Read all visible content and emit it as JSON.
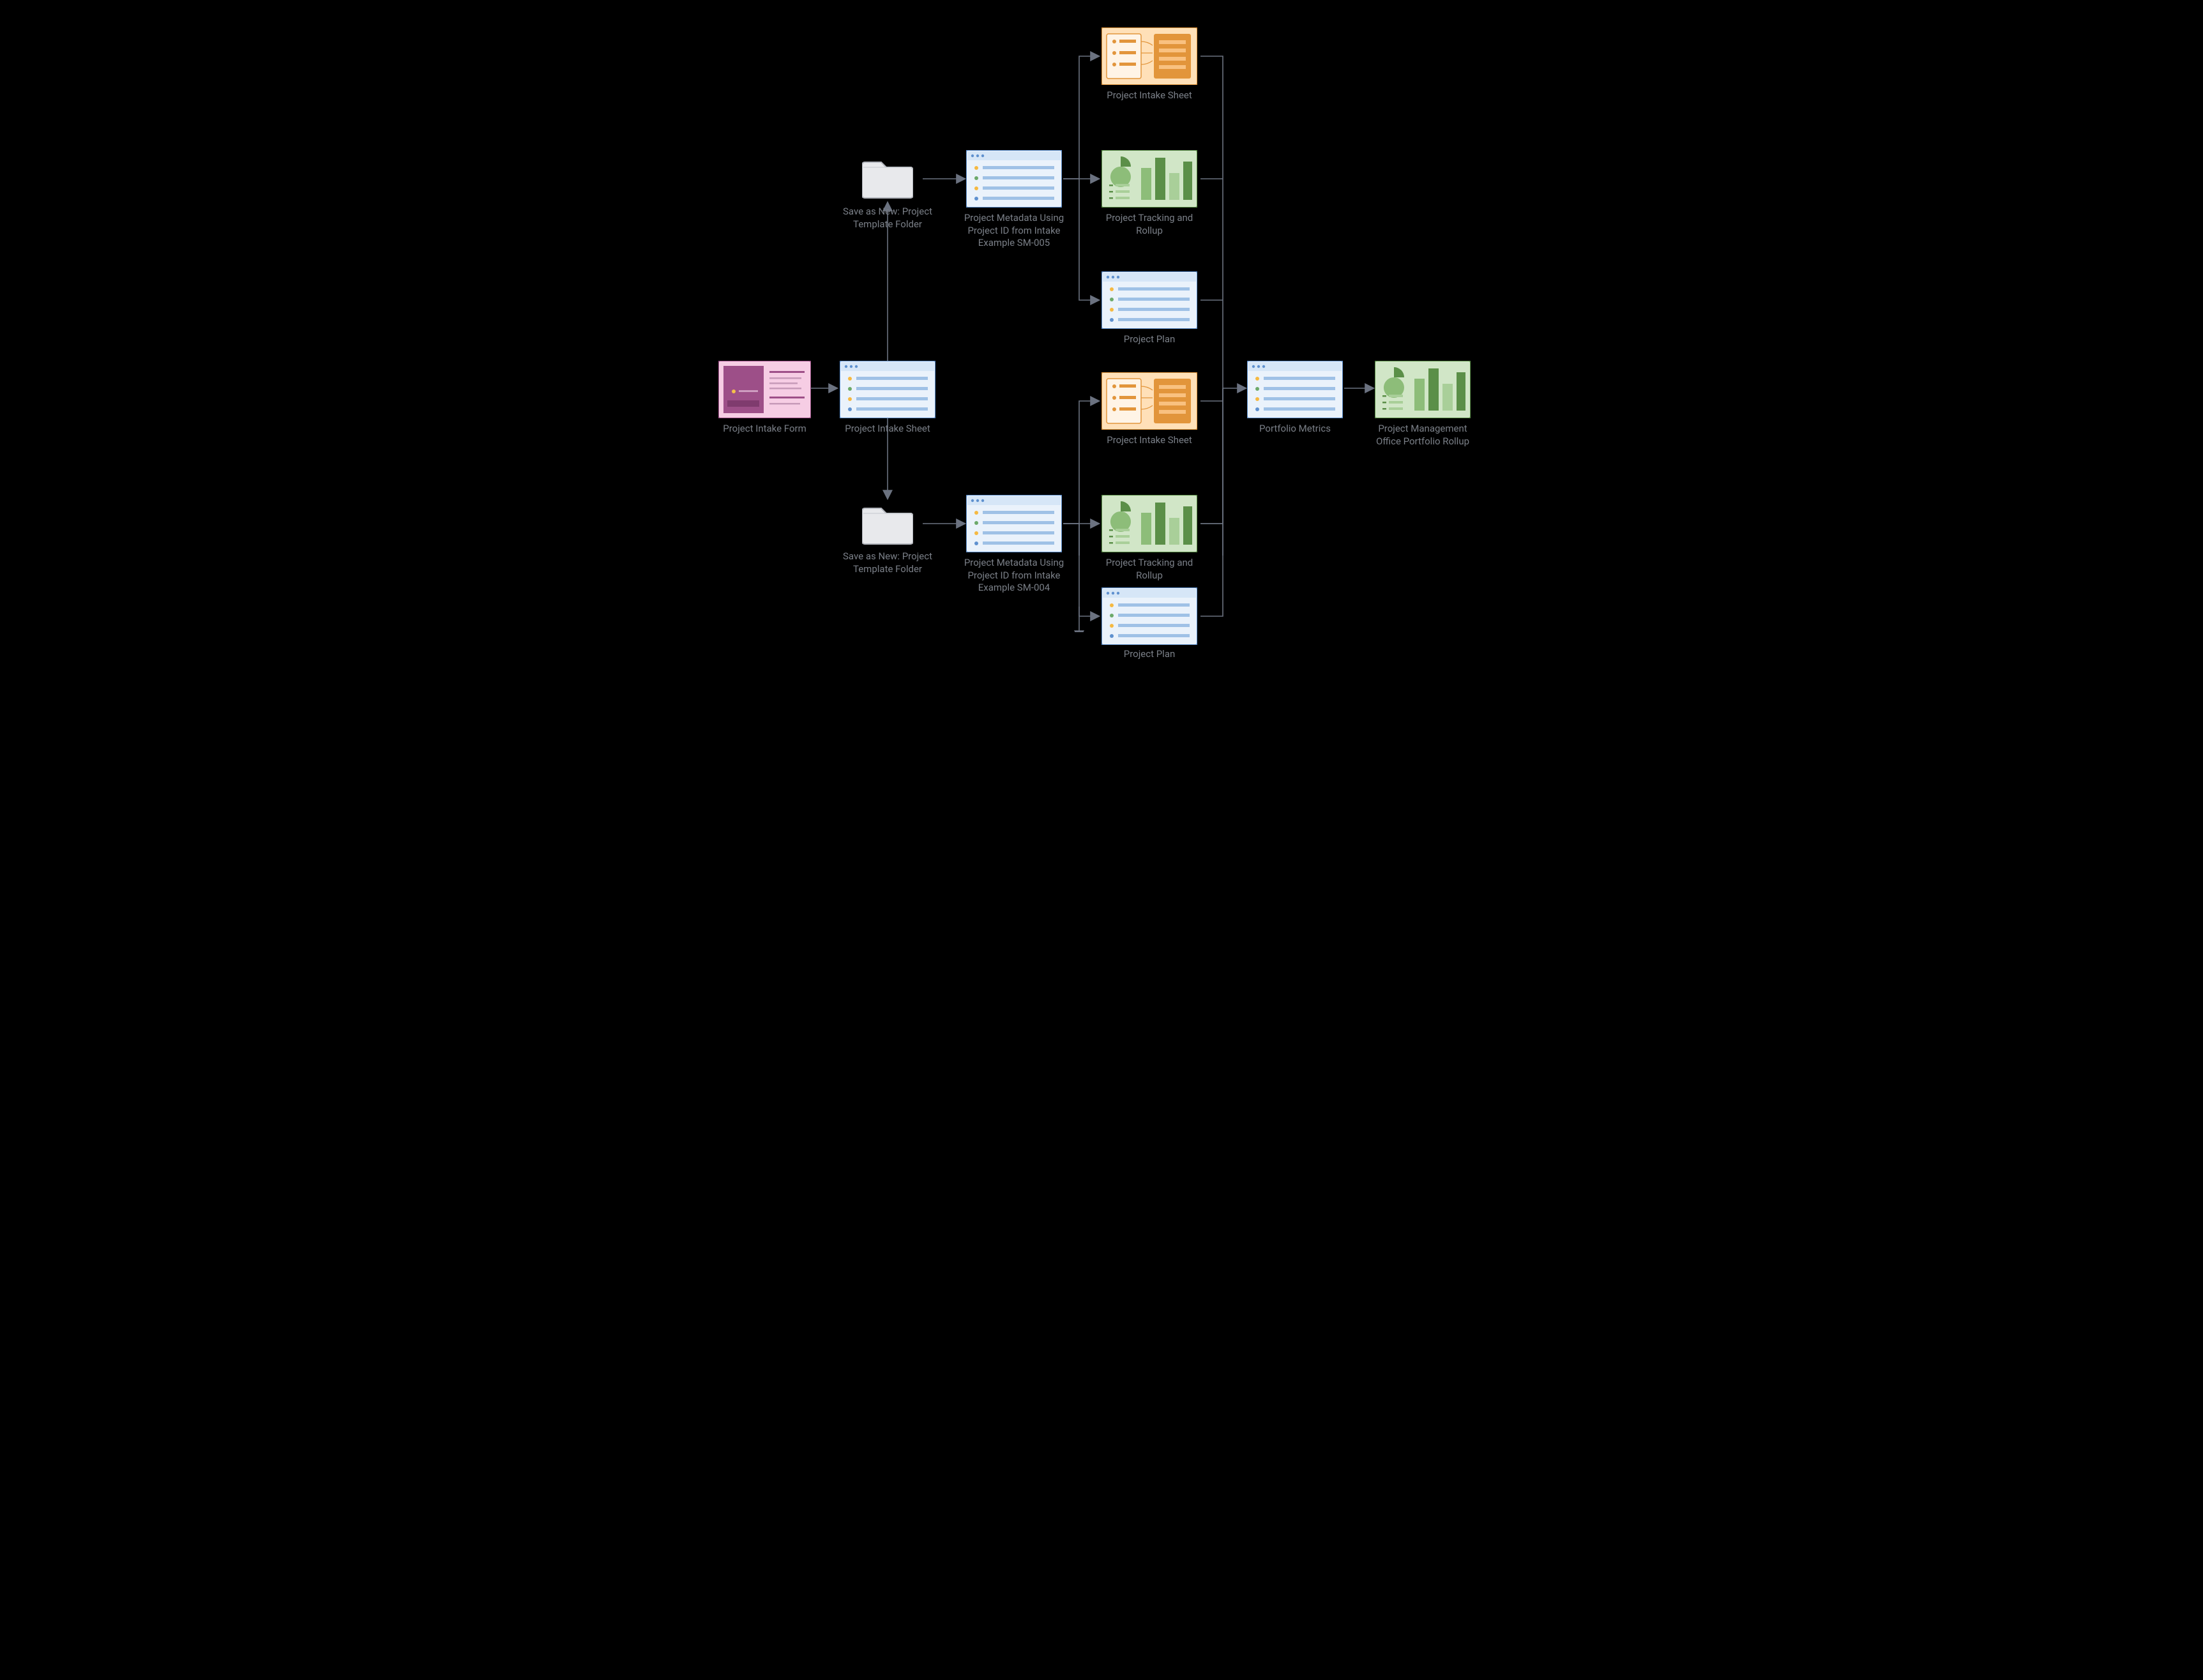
{
  "nodes": {
    "intake_form": {
      "label": "Project Intake Form"
    },
    "intake_sheet": {
      "label": "Project Intake Sheet"
    },
    "template_folder_1": {
      "label": "Save as New: Project Template Folder"
    },
    "template_folder_2": {
      "label": "Save as New: Project Template Folder"
    },
    "metadata_005": {
      "label": "Project Metadata Using Project ID from Intake Example SM-005"
    },
    "metadata_004": {
      "label": "Project Metadata Using Project ID from Intake Example SM-004"
    },
    "proj_intake_a": {
      "label": "Project Intake Sheet"
    },
    "tracking_a": {
      "label": "Project Tracking and Rollup"
    },
    "plan_a": {
      "label": "Project Plan"
    },
    "proj_intake_b": {
      "label": "Project Intake Sheet"
    },
    "tracking_b": {
      "label": "Project Tracking and Rollup"
    },
    "plan_b": {
      "label": "Project Plan"
    },
    "portfolio_metrics": {
      "label": "Portfolio Metrics"
    },
    "pmo_rollup": {
      "label": "Project Management Office Portfolio Rollup"
    }
  }
}
